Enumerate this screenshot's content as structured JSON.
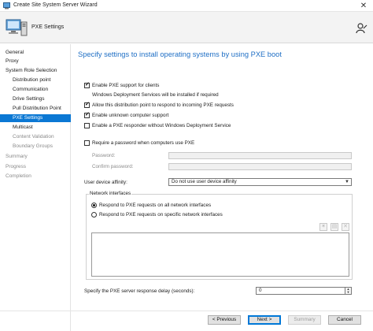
{
  "window": {
    "title": "Create Site System Server Wizard",
    "close_glyph": "✕"
  },
  "header": {
    "title": "PXE Settings",
    "icon": "computer-icon",
    "help_icon": "person-icon"
  },
  "nav": [
    {
      "label": "General",
      "level": "top",
      "state": "normal"
    },
    {
      "label": "Proxy",
      "level": "top",
      "state": "normal"
    },
    {
      "label": "System Role Selection",
      "level": "top",
      "state": "normal"
    },
    {
      "label": "Distribution point",
      "level": "sub",
      "state": "normal"
    },
    {
      "label": "Communication",
      "level": "sub",
      "state": "normal"
    },
    {
      "label": "Drive Settings",
      "level": "sub",
      "state": "normal"
    },
    {
      "label": "Pull Distribution Point",
      "level": "sub",
      "state": "normal"
    },
    {
      "label": "PXE Settings",
      "level": "sub",
      "state": "active"
    },
    {
      "label": "Multicast",
      "level": "sub",
      "state": "normal"
    },
    {
      "label": "Content Validation",
      "level": "sub",
      "state": "dim"
    },
    {
      "label": "Boundary Groups",
      "level": "sub",
      "state": "dim"
    },
    {
      "label": "Summary",
      "level": "top",
      "state": "dim"
    },
    {
      "label": "Progress",
      "level": "top",
      "state": "dim"
    },
    {
      "label": "Completion",
      "level": "top",
      "state": "dim"
    }
  ],
  "main": {
    "title": "Specify settings to install operating systems by using PXE boot",
    "enable_pxe": {
      "label": "Enable PXE support for clients",
      "checked": true
    },
    "wds_note": "Windows Deployment Services will be installed if required",
    "allow_respond": {
      "label": "Allow this distribution point to respond to incoming PXE requests",
      "checked": true
    },
    "unknown_support": {
      "label": "Enable unknown computer support",
      "checked": true
    },
    "pxe_responder": {
      "label": "Enable a PXE responder without Windows Deployment Service",
      "checked": false
    },
    "require_password": {
      "label": "Require a password when computers use PXE",
      "checked": false
    },
    "password_label": "Password:",
    "confirm_password_label": "Confirm password:",
    "affinity": {
      "label": "User device affinity:",
      "value": "Do not use user device affinity"
    },
    "network": {
      "group_label": "Network interfaces",
      "all_label": "Respond to PXE requests on all network interfaces",
      "specific_label": "Respond to PXE requests on specific network interfaces",
      "selected": "all"
    },
    "delay": {
      "label": "Specify the PXE server response delay (seconds):",
      "value": "0"
    }
  },
  "footer": {
    "previous": "< Previous",
    "next": "Next >",
    "summary": "Summary",
    "cancel": "Cancel"
  }
}
